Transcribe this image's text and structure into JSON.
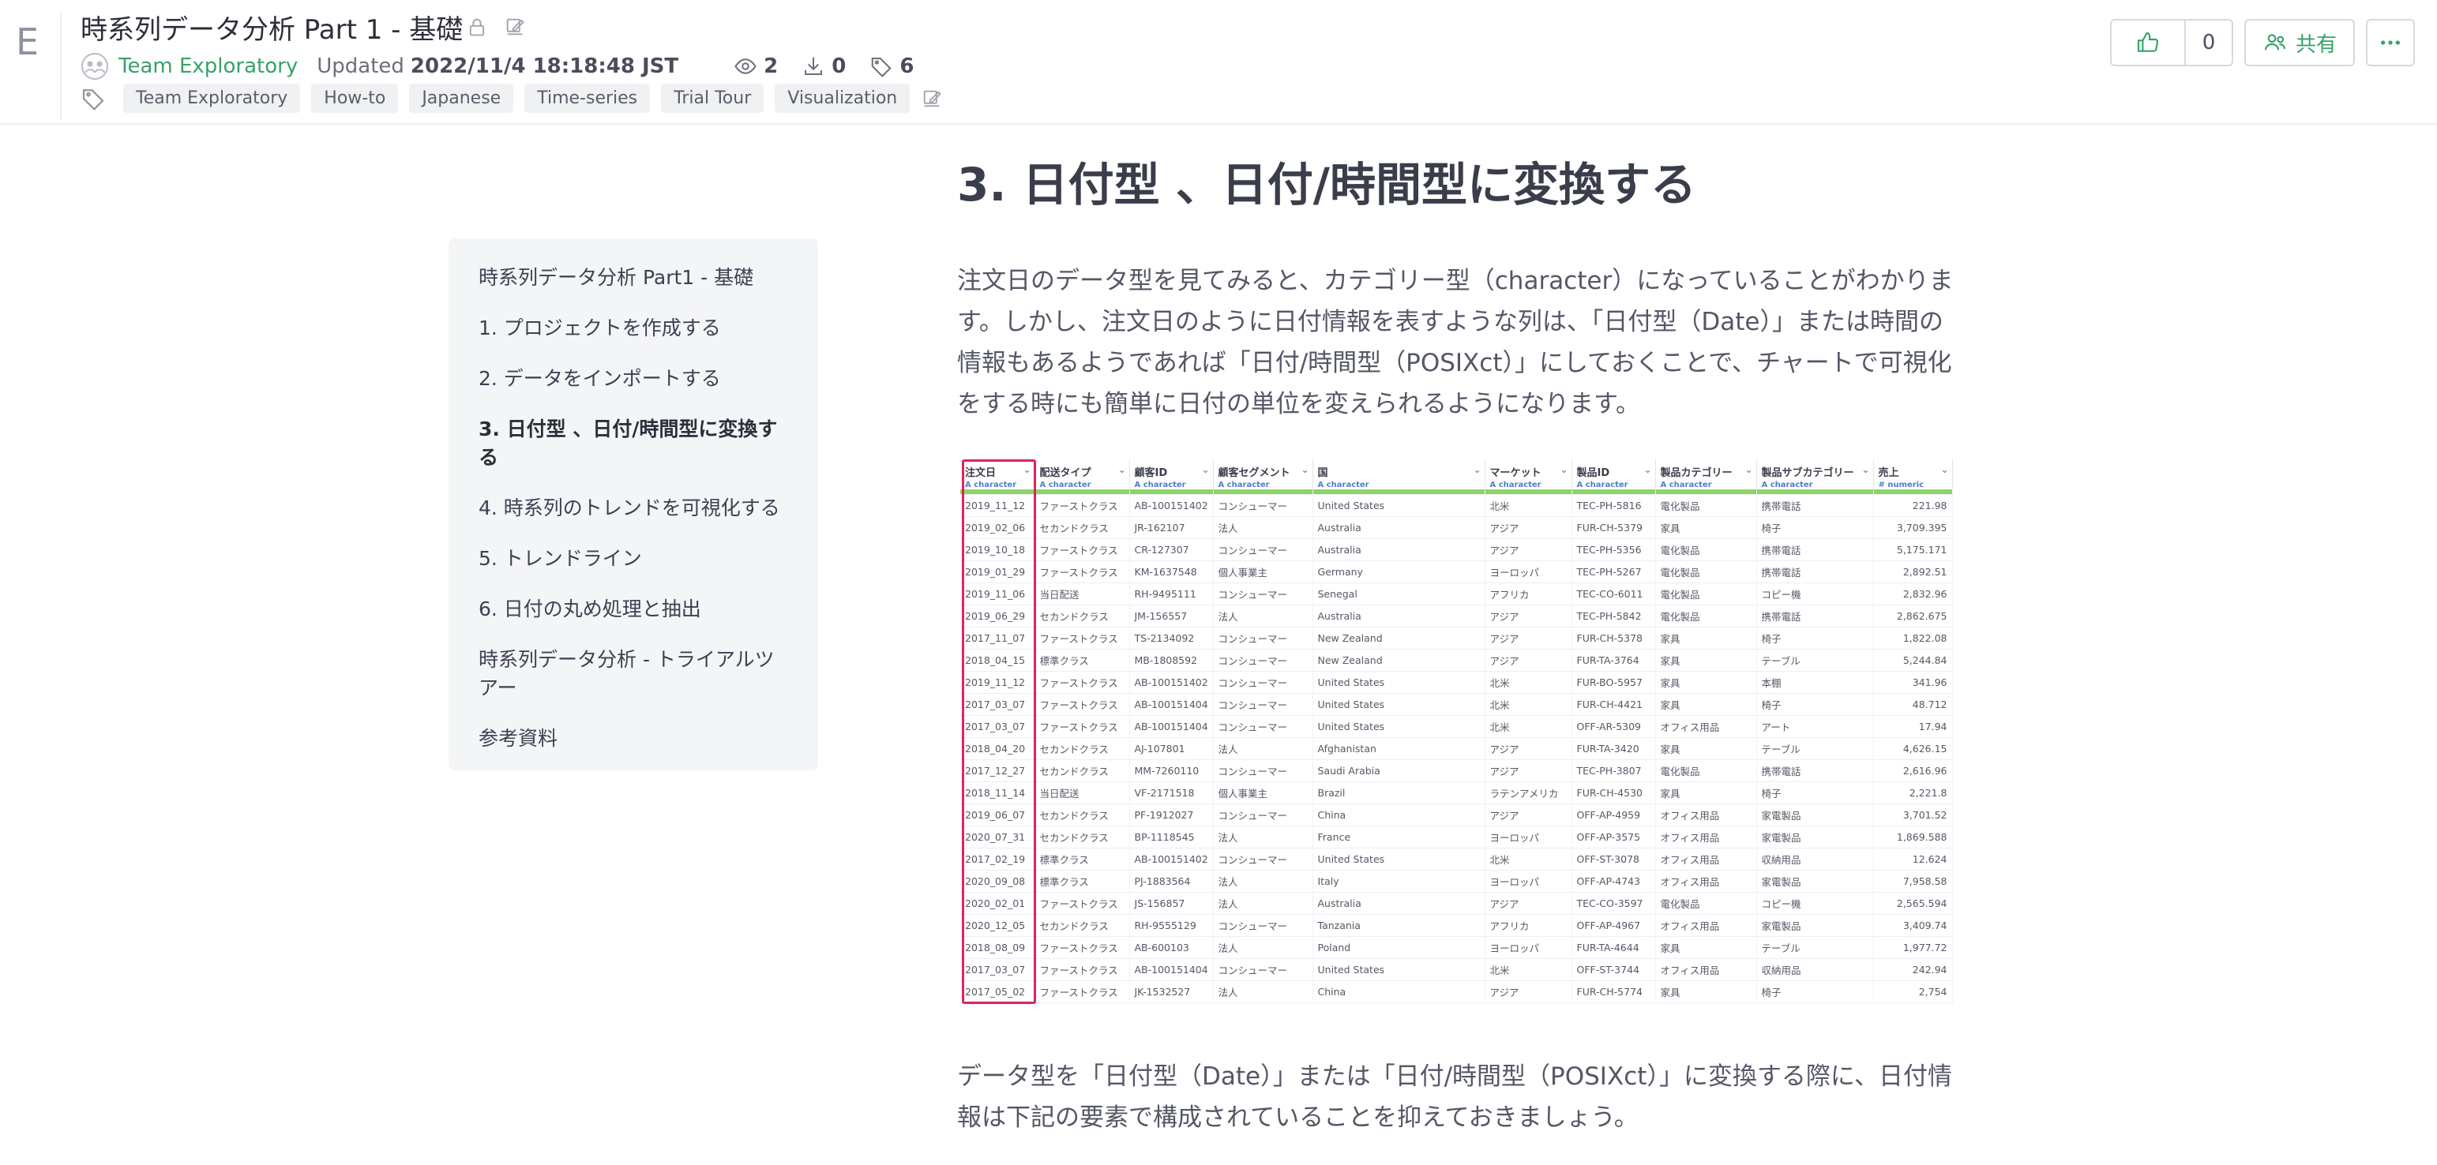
{
  "app": {
    "logo": "E"
  },
  "header": {
    "title": "時系列データ分析 Part 1 - 基礎",
    "team": "Team Exploratory",
    "updated_label": "Updated",
    "updated_date": "2022/11/4 18:18:48 JST",
    "views": "2",
    "downloads": "0",
    "tag_count": "6",
    "tags": [
      "Team Exploratory",
      "How-to",
      "Japanese",
      "Time-series",
      "Trial Tour",
      "Visualization"
    ],
    "like_count": "0",
    "share_label": "共有"
  },
  "toc": {
    "items": [
      "時系列データ分析 Part1 - 基礎",
      "1. プロジェクトを作成する",
      "2. データをインポートする",
      "3. 日付型 、日付/時間型に変換する",
      "4. 時系列のトレンドを可視化する",
      "5. トレンドライン",
      "6. 日付の丸め処理と抽出",
      "時系列データ分析 - トライアルツアー",
      "参考資料"
    ],
    "active_index": 3
  },
  "article": {
    "heading": "3. 日付型 、日付/時間型に変換する",
    "paragraph1": "注文日のデータ型を見てみると、カテゴリー型（character）になっていることがわかります。しかし、注文日のように日付情報を表すような列は、「日付型（Date）」または時間の情報もあるようであれば「日付/時間型（POSIXct）」にしておくことで、チャートで可視化をする時にも簡単に日付の単位を変えられるようになります。",
    "paragraph2": "データ型を「日付型（Date）」または「日付/時間型（POSIXct）」に変換する際に、日付情報は下記の要素で構成されていることを抑えておきましょう。"
  },
  "table": {
    "columns": [
      {
        "name": "注文日",
        "type": "A character"
      },
      {
        "name": "配送タイプ",
        "type": "A character"
      },
      {
        "name": "顧客ID",
        "type": "A character"
      },
      {
        "name": "顧客セグメント",
        "type": "A character"
      },
      {
        "name": "国",
        "type": "A character"
      },
      {
        "name": "マーケット",
        "type": "A character"
      },
      {
        "name": "製品ID",
        "type": "A character"
      },
      {
        "name": "製品カテゴリー",
        "type": "A character"
      },
      {
        "name": "製品サブカテゴリー",
        "type": "A character"
      },
      {
        "name": "売上",
        "type": "# numeric"
      }
    ],
    "rows": [
      [
        "2019_11_12",
        "ファーストクラス",
        "AB-100151402",
        "コンシューマー",
        "United States",
        "北米",
        "TEC-PH-5816",
        "電化製品",
        "携帯電話",
        "221.98"
      ],
      [
        "2019_02_06",
        "セカンドクラス",
        "JR-162107",
        "法人",
        "Australia",
        "アジア",
        "FUR-CH-5379",
        "家具",
        "椅子",
        "3,709.395"
      ],
      [
        "2019_10_18",
        "ファーストクラス",
        "CR-127307",
        "コンシューマー",
        "Australia",
        "アジア",
        "TEC-PH-5356",
        "電化製品",
        "携帯電話",
        "5,175.171"
      ],
      [
        "2019_01_29",
        "ファーストクラス",
        "KM-1637548",
        "個人事業主",
        "Germany",
        "ヨーロッパ",
        "TEC-PH-5267",
        "電化製品",
        "携帯電話",
        "2,892.51"
      ],
      [
        "2019_11_06",
        "当日配送",
        "RH-9495111",
        "コンシューマー",
        "Senegal",
        "アフリカ",
        "TEC-CO-6011",
        "電化製品",
        "コピー機",
        "2,832.96"
      ],
      [
        "2019_06_29",
        "セカンドクラス",
        "JM-156557",
        "法人",
        "Australia",
        "アジア",
        "TEC-PH-5842",
        "電化製品",
        "携帯電話",
        "2,862.675"
      ],
      [
        "2017_11_07",
        "ファーストクラス",
        "TS-2134092",
        "コンシューマー",
        "New Zealand",
        "アジア",
        "FUR-CH-5378",
        "家具",
        "椅子",
        "1,822.08"
      ],
      [
        "2018_04_15",
        "標準クラス",
        "MB-1808592",
        "コンシューマー",
        "New Zealand",
        "アジア",
        "FUR-TA-3764",
        "家具",
        "テーブル",
        "5,244.84"
      ],
      [
        "2019_11_12",
        "ファーストクラス",
        "AB-100151402",
        "コンシューマー",
        "United States",
        "北米",
        "FUR-BO-5957",
        "家具",
        "本棚",
        "341.96"
      ],
      [
        "2017_03_07",
        "ファーストクラス",
        "AB-100151404",
        "コンシューマー",
        "United States",
        "北米",
        "FUR-CH-4421",
        "家具",
        "椅子",
        "48.712"
      ],
      [
        "2017_03_07",
        "ファーストクラス",
        "AB-100151404",
        "コンシューマー",
        "United States",
        "北米",
        "OFF-AR-5309",
        "オフィス用品",
        "アート",
        "17.94"
      ],
      [
        "2018_04_20",
        "セカンドクラス",
        "AJ-107801",
        "法人",
        "Afghanistan",
        "アジア",
        "FUR-TA-3420",
        "家具",
        "テーブル",
        "4,626.15"
      ],
      [
        "2017_12_27",
        "セカンドクラス",
        "MM-7260110",
        "コンシューマー",
        "Saudi Arabia",
        "アジア",
        "TEC-PH-3807",
        "電化製品",
        "携帯電話",
        "2,616.96"
      ],
      [
        "2018_11_14",
        "当日配送",
        "VF-2171518",
        "個人事業主",
        "Brazil",
        "ラテンアメリカ",
        "FUR-CH-4530",
        "家具",
        "椅子",
        "2,221.8"
      ],
      [
        "2019_06_07",
        "セカンドクラス",
        "PF-1912027",
        "コンシューマー",
        "China",
        "アジア",
        "OFF-AP-4959",
        "オフィス用品",
        "家電製品",
        "3,701.52"
      ],
      [
        "2020_07_31",
        "セカンドクラス",
        "BP-1118545",
        "法人",
        "France",
        "ヨーロッパ",
        "OFF-AP-3575",
        "オフィス用品",
        "家電製品",
        "1,869.588"
      ],
      [
        "2017_02_19",
        "標準クラス",
        "AB-100151402",
        "コンシューマー",
        "United States",
        "北米",
        "OFF-ST-3078",
        "オフィス用品",
        "収納用品",
        "12.624"
      ],
      [
        "2020_09_08",
        "標準クラス",
        "PJ-1883564",
        "法人",
        "Italy",
        "ヨーロッパ",
        "OFF-AP-4743",
        "オフィス用品",
        "家電製品",
        "7,958.58"
      ],
      [
        "2020_02_01",
        "ファーストクラス",
        "JS-156857",
        "法人",
        "Australia",
        "アジア",
        "TEC-CO-3597",
        "電化製品",
        "コピー機",
        "2,565.594"
      ],
      [
        "2020_12_05",
        "セカンドクラス",
        "RH-9555129",
        "コンシューマー",
        "Tanzania",
        "アフリカ",
        "OFF-AP-4967",
        "オフィス用品",
        "家電製品",
        "3,409.74"
      ],
      [
        "2018_08_09",
        "ファーストクラス",
        "AB-600103",
        "法人",
        "Poland",
        "ヨーロッパ",
        "FUR-TA-4644",
        "家具",
        "テーブル",
        "1,977.72"
      ],
      [
        "2017_03_07",
        "ファーストクラス",
        "AB-100151404",
        "コンシューマー",
        "United States",
        "北米",
        "OFF-ST-3744",
        "オフィス用品",
        "収納用品",
        "242.94"
      ],
      [
        "2017_05_02",
        "ファーストクラス",
        "JK-1532527",
        "法人",
        "China",
        "アジア",
        "FUR-CH-5774",
        "家具",
        "椅子",
        "2,754"
      ]
    ]
  },
  "colors": {
    "accent_green": "#38a169",
    "highlight_red": "#e0245e",
    "type_bar_green": "#8fd46b"
  }
}
